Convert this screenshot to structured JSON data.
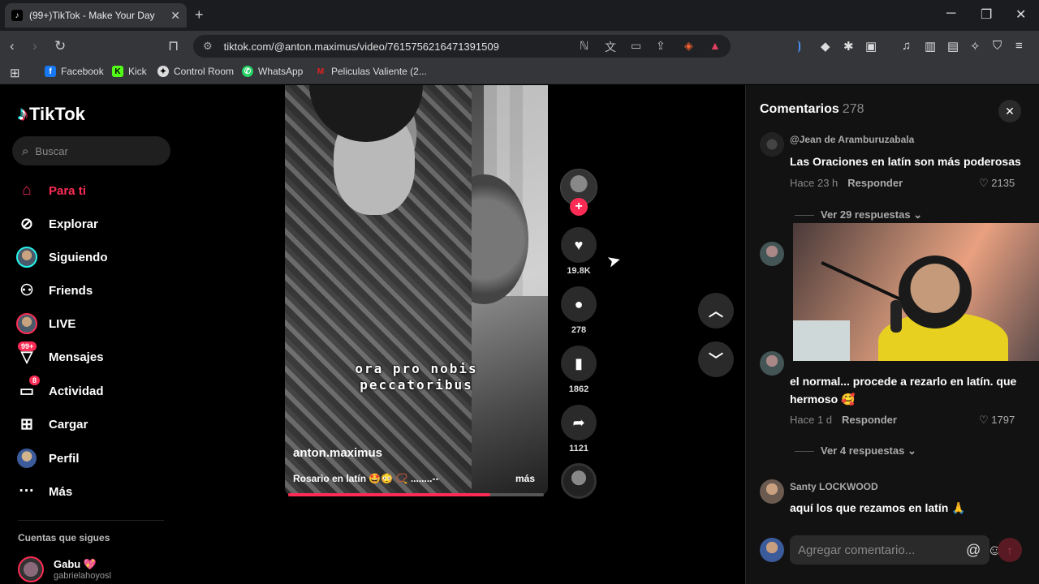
{
  "browser": {
    "tab_title": "(99+)TikTok - Make Your Day",
    "url": "tiktok.com/@anton.maximus/video/7615756216471391509",
    "bookmarks": [
      {
        "label": "Facebook",
        "icon": "facebook-icon",
        "color": "#1877f2"
      },
      {
        "label": "Kick",
        "icon": "kick-icon",
        "color": "#53fc18"
      },
      {
        "label": "Control Room",
        "icon": "control-room-icon",
        "color": "#dddddd"
      },
      {
        "label": "WhatsApp",
        "icon": "whatsapp-icon",
        "color": "#25d366"
      },
      {
        "label": "Peliculas Valiente (2...",
        "icon": "peliculas-icon",
        "color": "#e02020"
      }
    ]
  },
  "sidebar": {
    "logo": "TikTok",
    "search_placeholder": "Buscar",
    "items": [
      {
        "label": "Para ti",
        "icon": "home-icon"
      },
      {
        "label": "Explorar",
        "icon": "compass-icon"
      },
      {
        "label": "Siguiendo",
        "icon": "following-avatar"
      },
      {
        "label": "Friends",
        "icon": "friends-icon"
      },
      {
        "label": "LIVE",
        "icon": "live-avatar"
      },
      {
        "label": "Mensajes",
        "icon": "messages-icon",
        "badge": "99+"
      },
      {
        "label": "Actividad",
        "icon": "activity-icon",
        "badge": "8"
      },
      {
        "label": "Cargar",
        "icon": "upload-icon"
      },
      {
        "label": "Perfil",
        "icon": "profile-avatar"
      },
      {
        "label": "Más",
        "icon": "more-icon"
      }
    ],
    "following_title": "Cuentas que sigues",
    "following": [
      {
        "name": "Gabu 💖",
        "handle": "gabrielahoyosl"
      }
    ]
  },
  "video": {
    "caption_line1": "ora pro nobis",
    "caption_line2": "peccatoribus",
    "author": "anton.maximus",
    "description": "Rosario en latín 🤩😳 📿 ........--",
    "more": "más",
    "progress": 0.79
  },
  "actions": {
    "likes": "19.8K",
    "comments": "278",
    "saves": "1862",
    "shares": "1121"
  },
  "comments": {
    "title": "Comentarios",
    "count": "278",
    "input_placeholder": "Agregar comentario...",
    "items": [
      {
        "user": "@Jean de Aramburuzabala",
        "text": "Las Oraciones en latín son más poderosas",
        "time": "Hace 23 h",
        "reply": "Responder",
        "likes": "2135",
        "more_replies": "Ver 29 respuestas"
      },
      {
        "user": "",
        "text": "el normal... procede a rezarlo en latín. que hermoso 🥰",
        "time": "Hace 1 d",
        "reply": "Responder",
        "likes": "1797",
        "more_replies": "Ver 4 respuestas"
      },
      {
        "user": "Santy LOCKWOOD",
        "text": "aquí los que rezamos en latín 🙏"
      }
    ]
  },
  "colors": {
    "accent": "#fe2c55",
    "background": "#000000",
    "panel": "#121212"
  }
}
